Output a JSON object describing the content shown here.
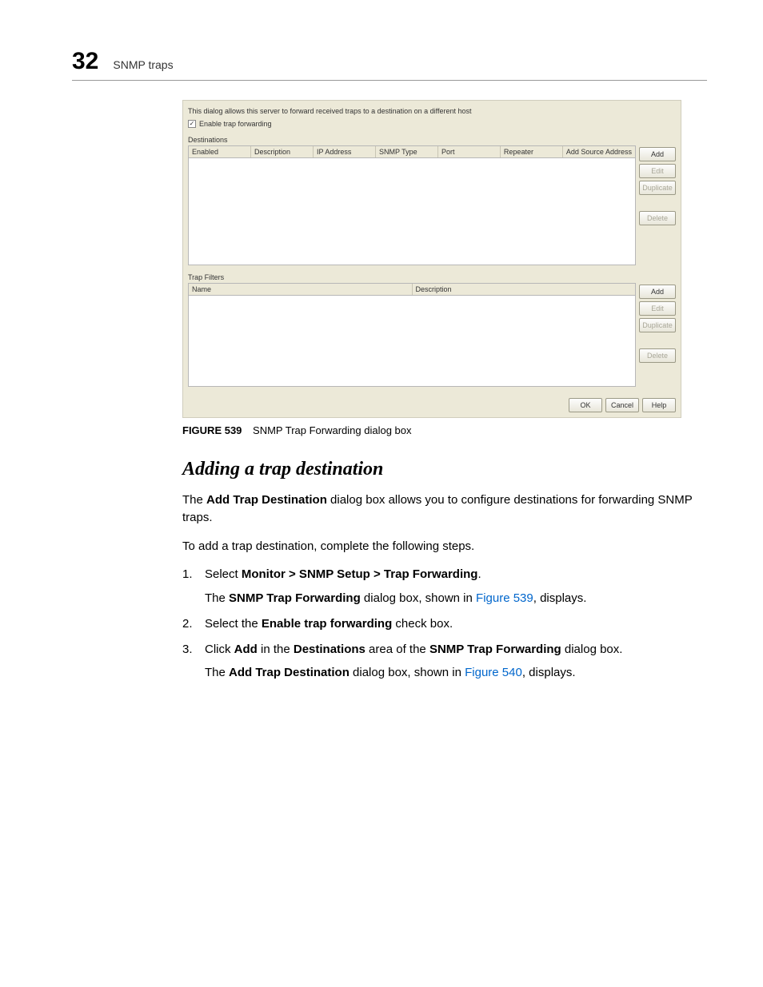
{
  "header": {
    "chapter_num": "32",
    "running_head": "SNMP traps"
  },
  "dialog": {
    "intro": "This dialog allows this server to forward received traps to a destination on a different host",
    "enable_checkbox_label": "Enable trap forwarding",
    "enable_checkbox_checked_glyph": "✓",
    "destinations": {
      "title": "Destinations",
      "columns": [
        "Enabled",
        "Description",
        "IP Address",
        "SNMP Type",
        "Port",
        "Repeater",
        "Add Source Address"
      ],
      "buttons": {
        "add": "Add",
        "edit": "Edit",
        "duplicate": "Duplicate",
        "delete": "Delete"
      }
    },
    "trap_filters": {
      "title": "Trap Filters",
      "columns": [
        "Name",
        "Description"
      ],
      "buttons": {
        "add": "Add",
        "edit": "Edit",
        "duplicate": "Duplicate",
        "delete": "Delete"
      }
    },
    "footer_buttons": {
      "ok": "OK",
      "cancel": "Cancel",
      "help": "Help"
    }
  },
  "fig_caption": {
    "label": "FIGURE 539",
    "text": "SNMP Trap Forwarding dialog box"
  },
  "section_heading": "Adding a trap destination",
  "intro_para": {
    "pre": "The ",
    "bold": "Add Trap Destination",
    "post": " dialog box allows you to configure destinations for forwarding SNMP traps."
  },
  "lead_in": "To add a trap destination, complete the following steps.",
  "steps": [
    {
      "pre": "Select ",
      "bold1": "Monitor > SNMP Setup > Trap Forwarding",
      "post1": ".",
      "sub_pre": "The ",
      "sub_bold": "SNMP Trap Forwarding",
      "sub_mid": " dialog box, shown in ",
      "sub_link": "Figure 539",
      "sub_post": ", displays."
    },
    {
      "pre": "Select the ",
      "bold1": "Enable trap forwarding",
      "post1": " check box."
    },
    {
      "pre": "Click ",
      "bold1": "Add",
      "mid1": " in the ",
      "bold2": "Destinations",
      "mid2": " area of the ",
      "bold3": "SNMP Trap Forwarding",
      "post1": " dialog box.",
      "sub_pre": "The ",
      "sub_bold": "Add Trap Destination",
      "sub_mid": " dialog box, shown in ",
      "sub_link": "Figure 540",
      "sub_post": ", displays."
    }
  ]
}
